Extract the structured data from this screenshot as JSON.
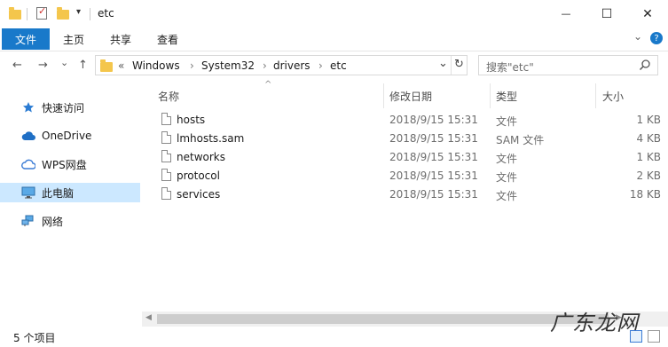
{
  "window": {
    "title": "etc",
    "minimize_glyph": "—",
    "maximize_glyph": "☐",
    "close_glyph": "✕"
  },
  "ribbon": {
    "file_tab": "文件",
    "tabs": [
      "主页",
      "共享",
      "查看"
    ],
    "collapse_glyph": "⌄",
    "help_glyph": "?"
  },
  "nav": {
    "back_glyph": "←",
    "forward_glyph": "→",
    "recent_glyph": "⌄",
    "up_glyph": "↑",
    "overflow_glyph": "«",
    "breadcrumbs": [
      "Windows",
      "System32",
      "drivers",
      "etc"
    ],
    "separator_glyph": "›",
    "dropdown_glyph": "⌄",
    "refresh_glyph": "↻"
  },
  "search": {
    "placeholder": "搜索\"etc\"",
    "icon": "search-icon"
  },
  "sidebar": {
    "items": [
      {
        "label": "快速访问",
        "icon": "pin-star-icon"
      },
      {
        "label": "OneDrive",
        "icon": "cloud-icon"
      },
      {
        "label": "WPS网盘",
        "icon": "wps-cloud-icon"
      },
      {
        "label": "此电脑",
        "icon": "monitor-icon",
        "selected": true
      },
      {
        "label": "网络",
        "icon": "network-icon"
      }
    ]
  },
  "table": {
    "columns": {
      "name": "名称",
      "date": "修改日期",
      "type": "类型",
      "size": "大小"
    },
    "sort_glyph": "^",
    "rows": [
      {
        "name": "hosts",
        "date": "2018/9/15 15:31",
        "type": "文件",
        "size": "1 KB"
      },
      {
        "name": "lmhosts.sam",
        "date": "2018/9/15 15:31",
        "type": "SAM 文件",
        "size": "4 KB"
      },
      {
        "name": "networks",
        "date": "2018/9/15 15:31",
        "type": "文件",
        "size": "1 KB"
      },
      {
        "name": "protocol",
        "date": "2018/9/15 15:31",
        "type": "文件",
        "size": "2 KB"
      },
      {
        "name": "services",
        "date": "2018/9/15 15:31",
        "type": "文件",
        "size": "18 KB"
      }
    ]
  },
  "scrollbar": {
    "left_glyph": "◀",
    "right_glyph": "▶"
  },
  "status": {
    "item_count": "5 个项目"
  },
  "watermark": "广东龙网",
  "colors": {
    "accent": "#1979ca",
    "selected": "#cce8ff",
    "folder": "#f4c64c"
  }
}
